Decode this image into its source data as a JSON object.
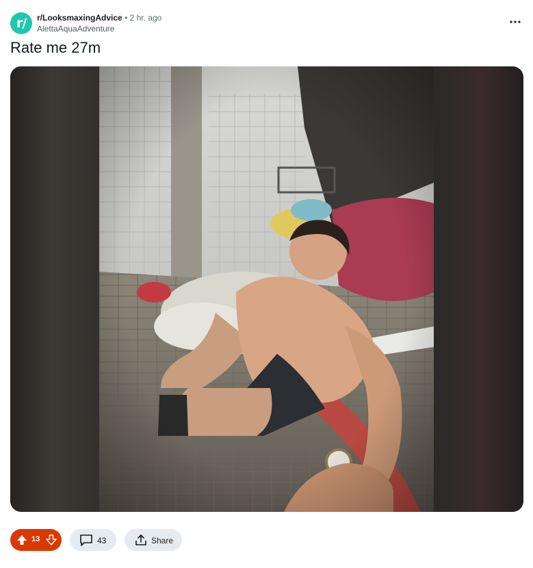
{
  "post": {
    "subreddit": "r/LooksmaxingAdvice",
    "separator": "•",
    "time": "2 hr. ago",
    "author": "AlettaAquaAdventure",
    "avatar_text": "r/",
    "title": "Rate me 27m",
    "image_description": "Shirtless man taking a selfie sitting on a handrail in a cluttered tiled courtyard"
  },
  "actions": {
    "upvotes": "13",
    "comments": "43",
    "share_label": "Share"
  },
  "colors": {
    "avatar": "#1fc7b0",
    "vote_active": "#d93900",
    "pill_bg": "#e5ebee"
  },
  "icons": [
    "more-options-icon",
    "upvote-icon",
    "downvote-icon",
    "comment-icon",
    "share-icon"
  ]
}
